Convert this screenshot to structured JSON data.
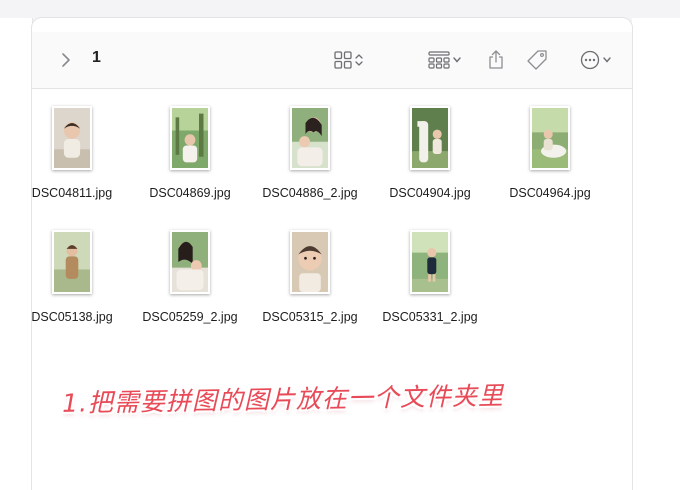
{
  "toolbar": {
    "folder_title": "1",
    "icons": [
      "chevron-right-icon",
      "grid-view-icon",
      "group-view-icon",
      "share-icon",
      "tag-icon",
      "more-icon"
    ]
  },
  "files": [
    {
      "name": "DSC04811.jpg"
    },
    {
      "name": "DSC04869.jpg"
    },
    {
      "name": "DSC04886_2.jpg"
    },
    {
      "name": "DSC04904.jpg"
    },
    {
      "name": "DSC04964.jpg"
    },
    {
      "name": "DSC05138.jpg"
    },
    {
      "name": "DSC05259_2.jpg"
    },
    {
      "name": "DSC05315_2.jpg"
    },
    {
      "name": "DSC05331_2.jpg"
    }
  ],
  "caption": "1.把需要拼图的图片放在一个文件夹里",
  "colors": {
    "caption": "#e84a57",
    "toolbar_bg": "#fafafa",
    "window_bg": "#ffffff"
  }
}
